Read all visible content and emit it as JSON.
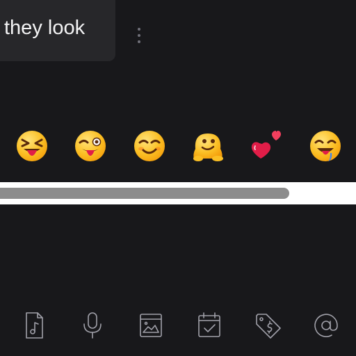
{
  "message": {
    "text": "they look",
    "more_icon": "more-vertical-icon"
  },
  "reactions": [
    {
      "name": "squinting-face-with-tongue",
      "icon": "squinting-tongue-emoji"
    },
    {
      "name": "winking-face-with-tongue",
      "icon": "winking-tongue-emoji"
    },
    {
      "name": "smiling-face-with-smile",
      "icon": "winking-smile-emoji"
    },
    {
      "name": "melting-face",
      "icon": "melting-face-emoji"
    },
    {
      "name": "two-hearts",
      "icon": "two-hearts-emoji"
    },
    {
      "name": "drooling-face",
      "icon": "drooling-face-emoji"
    }
  ],
  "scrollbar": {
    "visible": true,
    "position": "start"
  },
  "toolbar": [
    {
      "name": "audio-file",
      "icon": "music-file-icon"
    },
    {
      "name": "voice",
      "icon": "microphone-icon"
    },
    {
      "name": "image",
      "icon": "image-icon"
    },
    {
      "name": "schedule",
      "icon": "calendar-check-icon"
    },
    {
      "name": "price-tag",
      "icon": "price-tag-icon"
    },
    {
      "name": "mention",
      "icon": "at-sign-icon"
    }
  ],
  "colors": {
    "background": "#18181b",
    "bubble": "#27272a",
    "text": "#f4f4f5",
    "icon": "#a1a1aa",
    "emoji_face": "#fbbf24",
    "emoji_tongue": "#e11d48",
    "heart": "#f43f5e",
    "scroll_thumb": "#8c8c8c"
  }
}
